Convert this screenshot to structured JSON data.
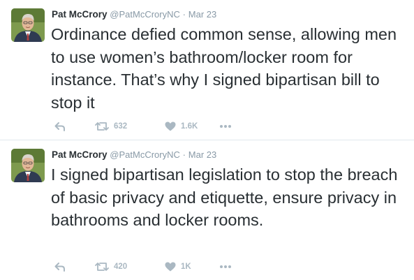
{
  "tweets": [
    {
      "author": "Pat McCrory",
      "handle": "@PatMcCroryNC",
      "separator": "·",
      "time": "Mar 23",
      "text": "Ordinance defied common sense, allowing men to use women’s bathroom/locker room for instance. That’s why I signed bipartisan bill to stop it",
      "retweets": "632",
      "likes": "1.6K"
    },
    {
      "author": "Pat McCrory",
      "handle": "@PatMcCroryNC",
      "separator": "·",
      "time": "Mar 23",
      "text": "I signed bipartisan legislation to stop the breach of basic privacy and etiquette, ensure privacy in bathrooms and locker rooms.",
      "retweets": "420",
      "likes": "1K"
    }
  ],
  "colors": {
    "text": "#292f33",
    "muted": "#8899a6",
    "icon": "#aab8c2",
    "divider": "#e1e8ed"
  },
  "icons": {
    "reply": "reply-icon",
    "retweet": "retweet-icon",
    "like": "heart-icon",
    "more": "more-icon"
  }
}
